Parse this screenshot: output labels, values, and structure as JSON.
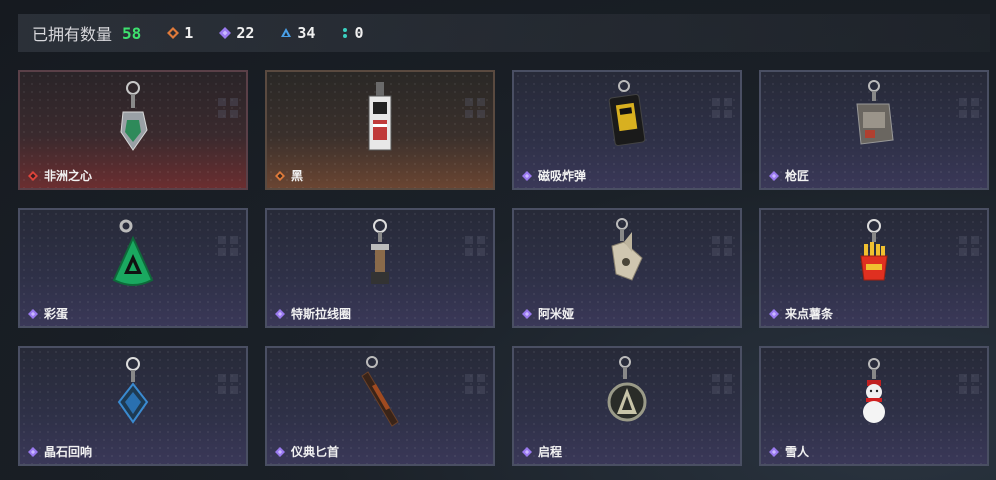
{
  "header": {
    "owned_label": "已拥有数量",
    "owned_count": "58",
    "rarity_counts": [
      {
        "icon": "orange-diamond-icon",
        "color": "#e07a3a",
        "count": "1"
      },
      {
        "icon": "purple-diamond-icon",
        "color": "#9a7af0",
        "count": "22"
      },
      {
        "icon": "blue-triangle-icon",
        "color": "#4aa0e8",
        "count": "34"
      },
      {
        "icon": "teal-dots-icon",
        "color": "#3ad0c0",
        "count": "0"
      }
    ]
  },
  "items": [
    {
      "name": "非洲之心",
      "rarity": "red",
      "icon": "heart-of-africa-charm-icon"
    },
    {
      "name": "黑",
      "rarity": "orange",
      "icon": "black-tag-charm-icon"
    },
    {
      "name": "磁吸炸弹",
      "rarity": "purple",
      "icon": "magnetic-bomb-charm-icon"
    },
    {
      "name": "枪匠",
      "rarity": "purple",
      "icon": "gunsmith-charm-icon"
    },
    {
      "name": "彩蛋",
      "rarity": "purple",
      "icon": "easter-egg-charm-icon"
    },
    {
      "name": "特斯拉线圈",
      "rarity": "purple",
      "icon": "tesla-coil-charm-icon"
    },
    {
      "name": "阿米娅",
      "rarity": "purple",
      "icon": "amiya-charm-icon"
    },
    {
      "name": "来点薯条",
      "rarity": "purple",
      "icon": "fries-charm-icon"
    },
    {
      "name": "晶石回响",
      "rarity": "purple",
      "icon": "crystal-echo-charm-icon"
    },
    {
      "name": "仪典匕首",
      "rarity": "purple",
      "icon": "ritual-dagger-charm-icon"
    },
    {
      "name": "启程",
      "rarity": "purple",
      "icon": "departure-charm-icon"
    },
    {
      "name": "雪人",
      "rarity": "purple",
      "icon": "snowman-charm-icon"
    }
  ],
  "rarity_colors": {
    "red": "#e0443a",
    "orange": "#e07a3a",
    "purple": "#9a7af0"
  }
}
